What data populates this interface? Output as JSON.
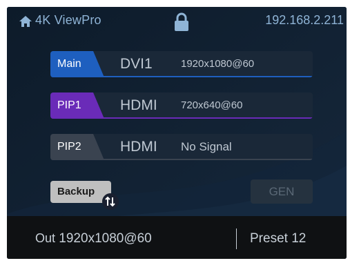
{
  "header": {
    "brand": "4K ViewPro",
    "ip": "192.168.2.211",
    "home_icon": "home-icon",
    "lock_icon": "lock-icon"
  },
  "layers": [
    {
      "tag": "Main",
      "source": "DVI1",
      "resolution": "1920x1080@60",
      "color": "#1e5fbf"
    },
    {
      "tag": "PIP1",
      "source": "HDMI",
      "resolution": "720x640@60",
      "color": "#6a2bb8"
    },
    {
      "tag": "PIP2",
      "source": "HDMI",
      "resolution": "No Signal",
      "color": "#3a4350"
    }
  ],
  "controls": {
    "backup_label": "Backup",
    "gen_label": "GEN"
  },
  "footer": {
    "out_label": "Out",
    "out_value": "1920x1080@60",
    "preset_label": "Preset",
    "preset_value": "12"
  },
  "colors": {
    "screen_bg": "#0d1b2a",
    "text_accent": "#8fb4d6"
  }
}
